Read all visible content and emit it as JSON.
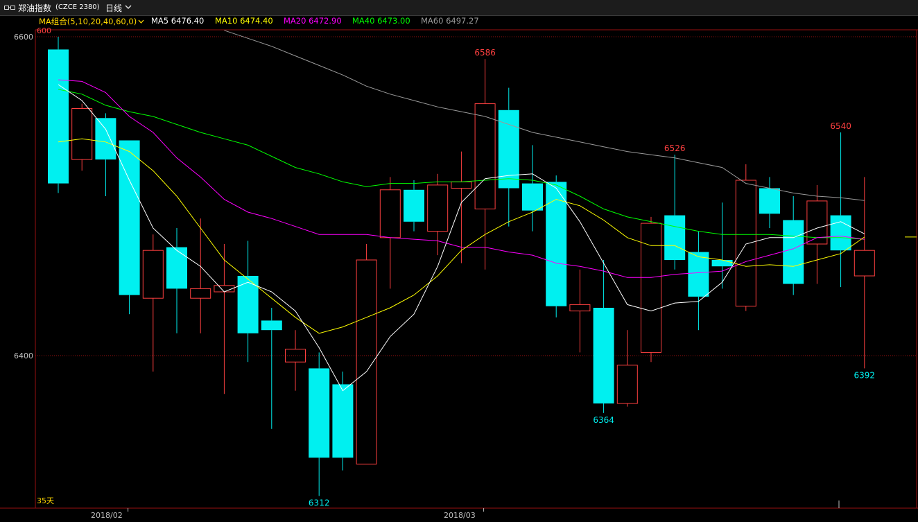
{
  "window": {
    "title": "郑油指数",
    "code": "(CZCE 2380)",
    "period_label": "日线"
  },
  "ma_legend": {
    "combo_label": "MA组合(5,10,20,40,60,0)",
    "items": [
      {
        "label": "MA5 6476.40",
        "color": "#ffffff"
      },
      {
        "label": "MA10 6474.40",
        "color": "#ffff00"
      },
      {
        "label": "MA20 6472.90",
        "color": "#ff00ff"
      },
      {
        "label": "MA40 6473.00",
        "color": "#00ff00"
      },
      {
        "label": "MA60 6497.27",
        "color": "#9a9a9a"
      }
    ]
  },
  "colors": {
    "up": "#ff4040",
    "down": "#00f0f0",
    "grid": "#9a1010",
    "axis_text": "#c0c0c0",
    "ma5": "#ffffff",
    "ma10": "#ffff00",
    "ma20": "#ff00ff",
    "ma40": "#00ff00",
    "ma60": "#9a9a9a"
  },
  "chart_data": {
    "type": "candlestick",
    "y_ticks": [
      "6600",
      "6400"
    ],
    "ylim": [
      6312,
      6600
    ],
    "candles": [
      {
        "open": 6592,
        "close": 6508,
        "high": 6600,
        "low": 6502,
        "dir": "down"
      },
      {
        "open": 6523,
        "close": 6555,
        "high": 6558,
        "low": 6516,
        "dir": "up"
      },
      {
        "open": 6549,
        "close": 6523,
        "high": 6552,
        "low": 6500,
        "dir": "down"
      },
      {
        "open": 6535,
        "close": 6438,
        "high": 6535,
        "low": 6426,
        "dir": "down"
      },
      {
        "open": 6436,
        "close": 6466,
        "high": 6476,
        "low": 6390,
        "dir": "up"
      },
      {
        "open": 6468,
        "close": 6442,
        "high": 6480,
        "low": 6414,
        "dir": "down"
      },
      {
        "open": 6436,
        "close": 6442,
        "high": 6486,
        "low": 6414,
        "dir": "up"
      },
      {
        "open": 6440,
        "close": 6444,
        "high": 6470,
        "low": 6376,
        "dir": "up"
      },
      {
        "open": 6450,
        "close": 6414,
        "high": 6472,
        "low": 6396,
        "dir": "down"
      },
      {
        "open": 6422,
        "close": 6416,
        "high": 6430,
        "low": 6354,
        "dir": "down"
      },
      {
        "open": 6396,
        "close": 6404,
        "high": 6416,
        "low": 6378,
        "dir": "up"
      },
      {
        "open": 6392,
        "close": 6336,
        "high": 6402,
        "low": 6312,
        "dir": "down"
      },
      {
        "open": 6382,
        "close": 6336,
        "high": 6390,
        "low": 6328,
        "dir": "down"
      },
      {
        "open": 6332,
        "close": 6460,
        "high": 6470,
        "low": 6332,
        "dir": "up"
      },
      {
        "open": 6474,
        "close": 6504,
        "high": 6512,
        "low": 6442,
        "dir": "up"
      },
      {
        "open": 6504,
        "close": 6484,
        "high": 6510,
        "low": 6478,
        "dir": "down"
      },
      {
        "open": 6478,
        "close": 6507,
        "high": 6514,
        "low": 6463,
        "dir": "up"
      },
      {
        "open": 6505,
        "close": 6509,
        "high": 6528,
        "low": 6458,
        "dir": "up"
      },
      {
        "open": 6492,
        "close": 6558,
        "high": 6586,
        "low": 6454,
        "dir": "up"
      },
      {
        "open": 6554,
        "close": 6505,
        "high": 6568,
        "low": 6481,
        "dir": "down"
      },
      {
        "open": 6508,
        "close": 6491,
        "high": 6532,
        "low": 6478,
        "dir": "down"
      },
      {
        "open": 6509,
        "close": 6431,
        "high": 6513,
        "low": 6424,
        "dir": "down"
      },
      {
        "open": 6428,
        "close": 6432,
        "high": 6454,
        "low": 6402,
        "dir": "up"
      },
      {
        "open": 6430,
        "close": 6370,
        "high": 6460,
        "low": 6364,
        "dir": "down"
      },
      {
        "open": 6370,
        "close": 6394,
        "high": 6416,
        "low": 6368,
        "dir": "up"
      },
      {
        "open": 6402,
        "close": 6483,
        "high": 6487,
        "low": 6396,
        "dir": "up"
      },
      {
        "open": 6488,
        "close": 6460,
        "high": 6526,
        "low": 6454,
        "dir": "down"
      },
      {
        "open": 6465,
        "close": 6437,
        "high": 6478,
        "low": 6416,
        "dir": "down"
      },
      {
        "open": 6460,
        "close": 6456,
        "high": 6496,
        "low": 6442,
        "dir": "down"
      },
      {
        "open": 6431,
        "close": 6510,
        "high": 6520,
        "low": 6428,
        "dir": "up"
      },
      {
        "open": 6505,
        "close": 6489,
        "high": 6512,
        "low": 6480,
        "dir": "down"
      },
      {
        "open": 6485,
        "close": 6445,
        "high": 6500,
        "low": 6438,
        "dir": "down"
      },
      {
        "open": 6470,
        "close": 6497,
        "high": 6507,
        "low": 6445,
        "dir": "up"
      },
      {
        "open": 6488,
        "close": 6466,
        "high": 6540,
        "low": 6443,
        "dir": "down"
      },
      {
        "open": 6450,
        "close": 6466,
        "high": 6512,
        "low": 6392,
        "dir": "up"
      }
    ],
    "ma5": [
      6570,
      6560,
      6542,
      6510,
      6480,
      6466,
      6456,
      6440,
      6446,
      6440,
      6428,
      6405,
      6378,
      6390,
      6412,
      6426,
      6456,
      6496,
      6511,
      6513,
      6514,
      6505,
      6484,
      6458,
      6432,
      6428,
      6433,
      6434,
      6446,
      6470,
      6474,
      6474,
      6480,
      6484,
      6476.4
    ],
    "ma10": [
      6534,
      6536,
      6534,
      6528,
      6516,
      6500,
      6480,
      6460,
      6448,
      6436,
      6424,
      6414,
      6418,
      6424,
      6430,
      6438,
      6450,
      6466,
      6476,
      6484,
      6490,
      6498,
      6494,
      6485,
      6474,
      6469,
      6469,
      6462,
      6460,
      6456,
      6457,
      6456,
      6460,
      6464,
      6474.4
    ],
    "ma20": [
      6573,
      6572,
      6565,
      6550,
      6540,
      6524,
      6512,
      6498,
      6490,
      6486,
      6481,
      6476,
      6476,
      6476,
      6474,
      6473,
      6472,
      6468,
      6468,
      6465,
      6463,
      6458,
      6456,
      6453,
      6449,
      6449,
      6451,
      6452,
      6453,
      6459,
      6463,
      6467,
      6474,
      6475,
      6472.9
    ],
    "ma40": [
      6567,
      6564,
      6557,
      6553,
      6550,
      6545,
      6540,
      6536,
      6532,
      6525,
      6518,
      6514,
      6509,
      6506,
      6508,
      6508,
      6509,
      6509,
      6510,
      6511,
      6510,
      6507,
      6500,
      6492,
      6487,
      6484,
      6481,
      6478,
      6476,
      6476,
      6476,
      6475,
      6474,
      6474,
      6473.0
    ],
    "ma60": [
      null,
      null,
      null,
      null,
      null,
      null,
      null,
      6604,
      6599,
      6594,
      6588,
      6582,
      6576,
      6569,
      6564,
      6560,
      6556,
      6553,
      6550,
      6545,
      6540,
      6537,
      6534,
      6531,
      6528,
      6526,
      6524,
      6521,
      6518,
      6508,
      6505,
      6502,
      6500,
      6499,
      6497.27
    ],
    "labels": [
      {
        "text": "6586",
        "candle": 18,
        "pos": "above",
        "dir": "up"
      },
      {
        "text": "6526",
        "candle": 26,
        "pos": "above",
        "dir": "up"
      },
      {
        "text": "6540",
        "candle": 33,
        "pos": "above",
        "dir": "up"
      },
      {
        "text": "6312",
        "candle": 11,
        "pos": "below",
        "dir": "down"
      },
      {
        "text": "6364",
        "candle": 23,
        "pos": "below",
        "dir": "down"
      },
      {
        "text": "6392",
        "candle": 34,
        "pos": "below",
        "dir": "down"
      }
    ],
    "top_label": "600",
    "bottom_label": "35天",
    "x_ticks": [
      {
        "label": "2018/02",
        "candle": 3
      },
      {
        "label": "2018/03",
        "candle": 18
      }
    ]
  }
}
